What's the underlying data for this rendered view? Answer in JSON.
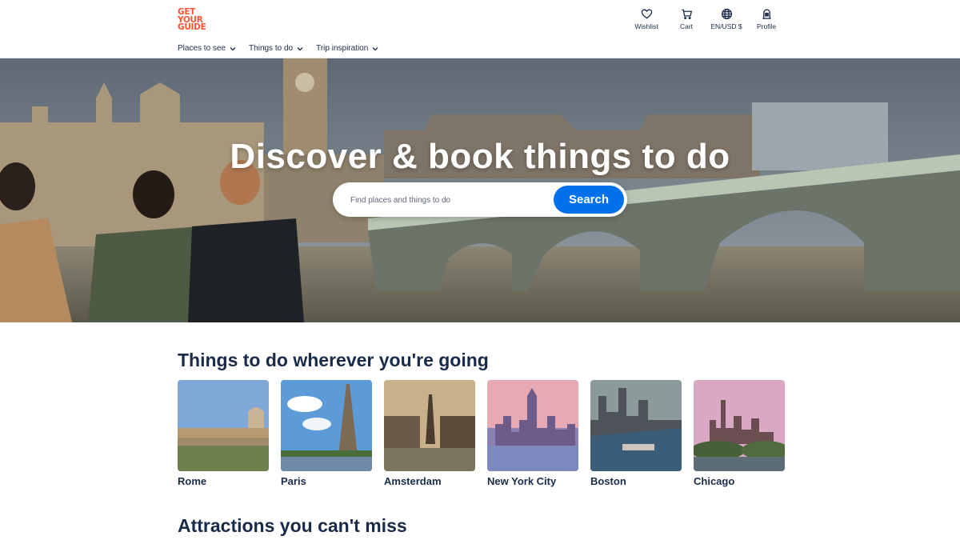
{
  "brand": {
    "logo_lines": [
      "GET",
      "YOUR",
      "GUIDE"
    ],
    "color": "#ff5533"
  },
  "header": {
    "icons": [
      {
        "label": "Wishlist",
        "icon": "heart-icon"
      },
      {
        "label": "Cart",
        "icon": "cart-icon"
      },
      {
        "label": "EN/USD $",
        "icon": "globe-icon"
      },
      {
        "label": "Profile",
        "icon": "profile-icon"
      }
    ],
    "menu": [
      {
        "label": "Places to see"
      },
      {
        "label": "Things to do"
      },
      {
        "label": "Trip inspiration"
      }
    ]
  },
  "hero": {
    "title": "Discover & book things to do",
    "search_placeholder": "Find places and things to do",
    "search_button": "Search",
    "accent": "#0071eb"
  },
  "destinations": {
    "title": "Things to do wherever you're going",
    "cities": [
      {
        "name": "Rome"
      },
      {
        "name": "Paris"
      },
      {
        "name": "Amsterdam"
      },
      {
        "name": "New York City"
      },
      {
        "name": "Boston"
      },
      {
        "name": "Chicago"
      }
    ]
  },
  "attractions": {
    "title": "Attractions you can't miss"
  }
}
